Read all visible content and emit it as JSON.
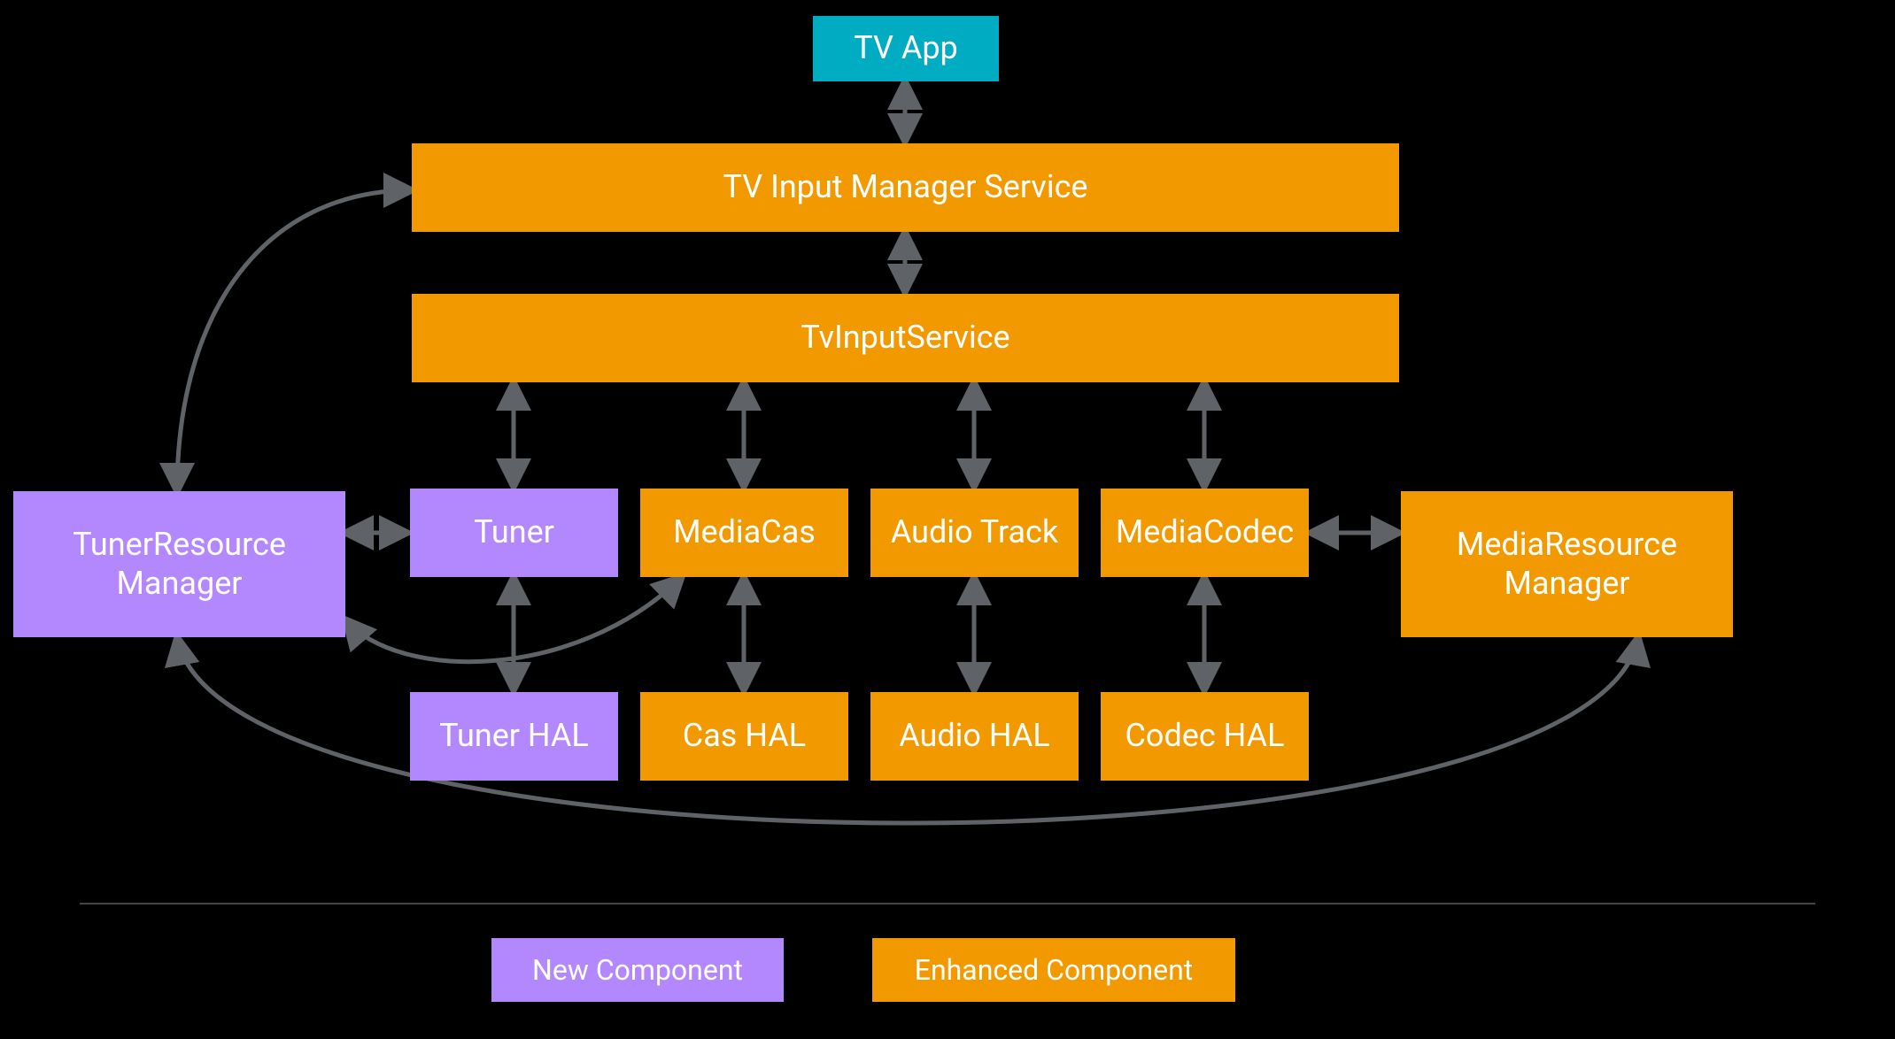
{
  "boxes": {
    "tv_app": "TV App",
    "tims": "TV Input Manager Service",
    "tis": "TvInputService",
    "tuner_res_mgr_l1": "TunerResource",
    "tuner_res_mgr_l2": "Manager",
    "tuner": "Tuner",
    "mediacas": "MediaCas",
    "audiotrack": "Audio Track",
    "mediacodec": "MediaCodec",
    "media_res_mgr_l1": "MediaResource",
    "media_res_mgr_l2": "Manager",
    "tuner_hal": "Tuner HAL",
    "cas_hal": "Cas HAL",
    "audio_hal": "Audio HAL",
    "codec_hal": "Codec HAL"
  },
  "legend": {
    "new": "New Component",
    "enhanced": "Enhanced Component"
  },
  "colors": {
    "blue": "#00acc1",
    "orange": "#f29900",
    "purple": "#b388ff",
    "arrow": "#5f6368"
  }
}
